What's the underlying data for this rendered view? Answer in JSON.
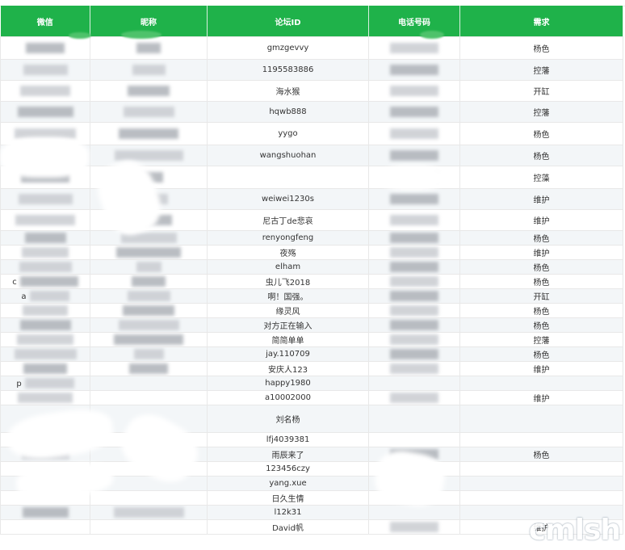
{
  "headers": {
    "wechat": "微信",
    "nickname": "昵称",
    "forum_id": "论坛ID",
    "phone": "电话号码",
    "demand": "需求"
  },
  "rows": [
    {
      "forum_id": "gmzgevvy",
      "demand": "杨色",
      "wx": 1,
      "nick": 1,
      "phone": 1
    },
    {
      "forum_id": "1195583886",
      "demand": "控藩",
      "wx": 1,
      "nick": 1,
      "phone": 1
    },
    {
      "forum_id": "海水猴",
      "demand": "开缸",
      "wx": 1,
      "nick": 1,
      "phone": 1
    },
    {
      "forum_id": "hqwb888",
      "demand": "控藩",
      "wx": 1,
      "nick": 1,
      "phone": 1
    },
    {
      "forum_id": "yygo",
      "demand": "杨色",
      "wx": 1,
      "nick": 1,
      "phone": 1
    },
    {
      "forum_id": "wangshuohan",
      "demand": "杨色",
      "wx": 1,
      "nick": 1,
      "phone": 1
    },
    {
      "forum_id": "",
      "demand": "控藻",
      "wx": 1,
      "nick": 1,
      "phone": 1
    },
    {
      "forum_id": "weiwei1230s",
      "demand": "维护",
      "wx": 1,
      "nick": 1,
      "phone": 1
    },
    {
      "forum_id": "尼古丁de悲哀",
      "demand": "维护",
      "wx": 1,
      "nick": 1,
      "phone": 1
    },
    {
      "forum_id": "renyongfeng",
      "demand": "杨色",
      "wx": 1,
      "nick": 1,
      "phone": 1
    },
    {
      "forum_id": "夜殇",
      "demand": "维护",
      "wx": 1,
      "nick": 1,
      "phone": 1
    },
    {
      "forum_id": "elham",
      "demand": "杨色",
      "wx": 1,
      "nick": 1,
      "phone": 1
    },
    {
      "forum_id": "虫儿飞2018",
      "demand": "杨色",
      "wx_prefix": "c",
      "wx": 1,
      "nick": 1,
      "phone": 1
    },
    {
      "forum_id": "啊！国强。",
      "demand": "开缸",
      "wx_prefix": "a",
      "wx": 1,
      "nick": 1,
      "phone": 1
    },
    {
      "forum_id": "缘灵风",
      "demand": "杨色",
      "wx": 1,
      "nick": 1,
      "phone": 1
    },
    {
      "forum_id": "对方正在输入",
      "demand": "杨色",
      "wx": 1,
      "nick": 1,
      "phone": 1
    },
    {
      "forum_id": "简简单单",
      "demand": "控藩",
      "wx": 1,
      "nick": 1,
      "phone": 1
    },
    {
      "forum_id": "jay.110709",
      "demand": "杨色",
      "wx": 1,
      "nick": 1,
      "phone": 1
    },
    {
      "forum_id": "安庆人123",
      "demand": "维护",
      "wx": 1,
      "nick": 1,
      "phone": 1
    },
    {
      "forum_id": "happy1980",
      "demand": "",
      "wx_prefix": "p",
      "wx": 1,
      "nick": 0,
      "phone": 0
    },
    {
      "forum_id": "a10002000",
      "demand": "维护",
      "wx": 1,
      "nick": 0,
      "phone": 1
    },
    {
      "forum_id": "刘名杨",
      "demand": "",
      "wx": 0,
      "nick": 0,
      "phone": 0
    },
    {
      "forum_id": "lfj4039381",
      "demand": "",
      "wx": 0,
      "nick": 0,
      "phone": 0
    },
    {
      "forum_id": "雨辰来了",
      "demand": "杨色",
      "wx": 1,
      "nick": 1,
      "phone": 1
    },
    {
      "forum_id": "123456czy",
      "demand": "",
      "wx": 0,
      "nick": 0,
      "phone": 0
    },
    {
      "forum_id": "yang.xue",
      "demand": "",
      "wx": 0,
      "nick": 0,
      "phone": 0
    },
    {
      "forum_id": "日久生情",
      "demand": "",
      "wx": 0,
      "nick": 0,
      "phone": 0
    },
    {
      "forum_id": "l12k31",
      "demand": "",
      "wx": 1,
      "nick": 1,
      "phone": 0
    },
    {
      "forum_id": "David帆",
      "demand": "维护",
      "wx": 0,
      "nick": 0,
      "phone": 1
    }
  ],
  "watermark": "cmlsh",
  "colors": {
    "header_bg": "#1fb24a",
    "header_text": "#ffffff",
    "stripe": "#f3f6f8"
  }
}
